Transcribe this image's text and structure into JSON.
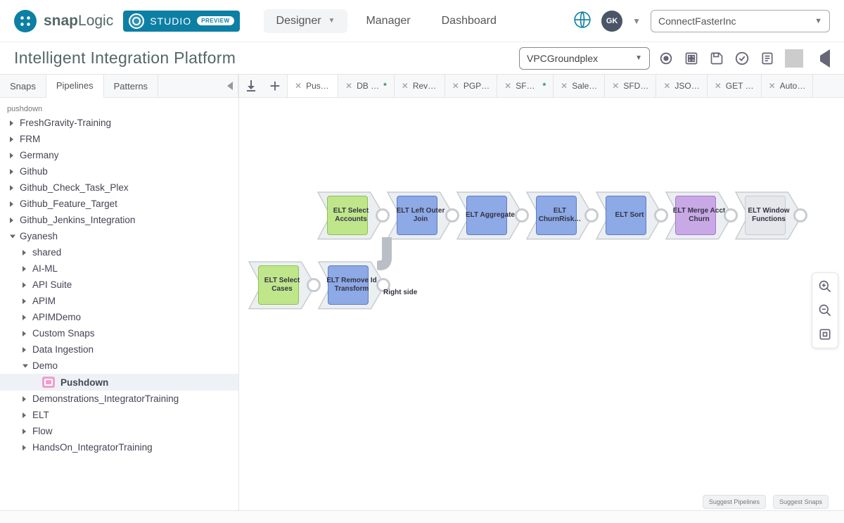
{
  "brand": {
    "name": "snapLogic",
    "studio": "STUDIO",
    "preview": "PREVIEW"
  },
  "nav": {
    "designer": "Designer",
    "manager": "Manager",
    "dashboard": "Dashboard"
  },
  "user": {
    "initials": "GK"
  },
  "org": {
    "selected": "ConnectFasterInc"
  },
  "subheader": {
    "title": "Intelligent Integration Platform",
    "plex": "VPCGroundplex"
  },
  "left_tabs": {
    "snaps": "Snaps",
    "pipelines": "Pipelines",
    "patterns": "Patterns"
  },
  "search": {
    "label": "pushdown"
  },
  "tree": [
    {
      "label": "FreshGravity-Training",
      "state": "closed",
      "level": 1
    },
    {
      "label": "FRM",
      "state": "closed",
      "level": 1
    },
    {
      "label": "Germany",
      "state": "closed",
      "level": 1
    },
    {
      "label": "Github",
      "state": "closed",
      "level": 1
    },
    {
      "label": "Github_Check_Task_Plex",
      "state": "closed",
      "level": 1
    },
    {
      "label": "Github_Feature_Target",
      "state": "closed",
      "level": 1
    },
    {
      "label": "Github_Jenkins_Integration",
      "state": "closed",
      "level": 1
    },
    {
      "label": "Gyanesh",
      "state": "open",
      "level": 1
    },
    {
      "label": "shared",
      "state": "closed",
      "level": 2
    },
    {
      "label": "AI-ML",
      "state": "closed",
      "level": 2
    },
    {
      "label": "API Suite",
      "state": "closed",
      "level": 2
    },
    {
      "label": "APIM",
      "state": "closed",
      "level": 2
    },
    {
      "label": "APIMDemo",
      "state": "closed",
      "level": 2
    },
    {
      "label": "Custom Snaps",
      "state": "closed",
      "level": 2
    },
    {
      "label": "Data Ingestion",
      "state": "closed",
      "level": 2
    },
    {
      "label": "Demo",
      "state": "open",
      "level": 2
    },
    {
      "label": "Pushdown",
      "state": "leaf",
      "level": 3,
      "selected": true
    },
    {
      "label": "Demonstrations_IntegratorTraining",
      "state": "closed",
      "level": 2
    },
    {
      "label": "ELT",
      "state": "closed",
      "level": 2
    },
    {
      "label": "Flow",
      "state": "closed",
      "level": 2
    },
    {
      "label": "HandsOn_IntegratorTraining",
      "state": "closed",
      "level": 2
    }
  ],
  "pipe_tabs": [
    {
      "label": "Pus…",
      "dirty": false,
      "active": true
    },
    {
      "label": "DB …",
      "dirty": true
    },
    {
      "label": "Rev…",
      "dirty": false
    },
    {
      "label": "PGP…",
      "dirty": false
    },
    {
      "label": "SF_…",
      "dirty": true
    },
    {
      "label": "Sale…",
      "dirty": false
    },
    {
      "label": "SFD…",
      "dirty": false
    },
    {
      "label": "JSO…",
      "dirty": false
    },
    {
      "label": "GET …",
      "dirty": false
    },
    {
      "label": "Auto…",
      "dirty": false
    }
  ],
  "snaps_row1": [
    {
      "label": "ELT Select Accounts",
      "color": "green"
    },
    {
      "label": "ELT Left Outer Join",
      "color": "blue"
    },
    {
      "label": "ELT Aggregate",
      "color": "blue"
    },
    {
      "label": "ELT ChurnRisk…",
      "color": "blue"
    },
    {
      "label": "ELT Sort",
      "color": "blue"
    },
    {
      "label": "ELT Merge Acct Churn",
      "color": "purple"
    },
    {
      "label": "ELT Window Functions",
      "color": "grey"
    }
  ],
  "snaps_row2": [
    {
      "label": "ELT Select Cases",
      "color": "green"
    },
    {
      "label": "ELT Remove Id Transform",
      "color": "blue"
    }
  ],
  "row2_tag": "Right side",
  "suggest": {
    "pipelines": "Suggest Pipelines",
    "snaps": "Suggest Snaps"
  }
}
